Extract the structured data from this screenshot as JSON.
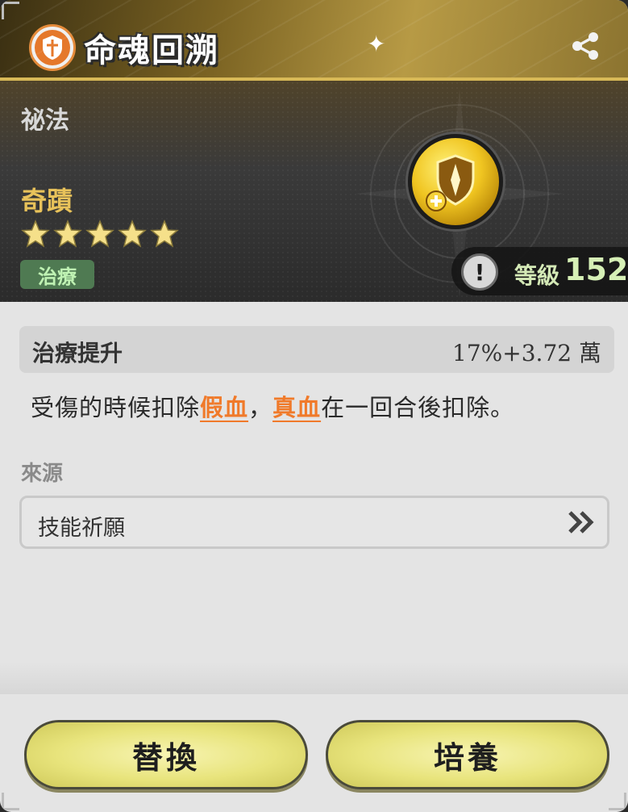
{
  "header": {
    "title": "命魂回溯",
    "title_icon": "shield-emblem-icon",
    "share_icon": "share-icon"
  },
  "hero": {
    "category": "祕法",
    "rarity": "奇蹟",
    "stars": 5,
    "tag": "治療",
    "level_label": "等級",
    "level_value": "152",
    "badge_icon": "golden-shield-medal-icon"
  },
  "stat": {
    "name": "治療提升",
    "value": "17%+3.72 萬"
  },
  "description": {
    "part1": "受傷的時候扣除",
    "keyword1": "假血",
    "part2": "，",
    "keyword2": "真血",
    "part3": "在一回合後扣除。"
  },
  "source": {
    "label": "來源",
    "item": "技能祈願"
  },
  "buttons": {
    "replace": "替換",
    "cultivate": "培養"
  },
  "colors": {
    "keyword": "#f07a2a",
    "tag_bg": "#4f7a52",
    "rarity": "#e8c25a",
    "button": "#e8e47c"
  }
}
